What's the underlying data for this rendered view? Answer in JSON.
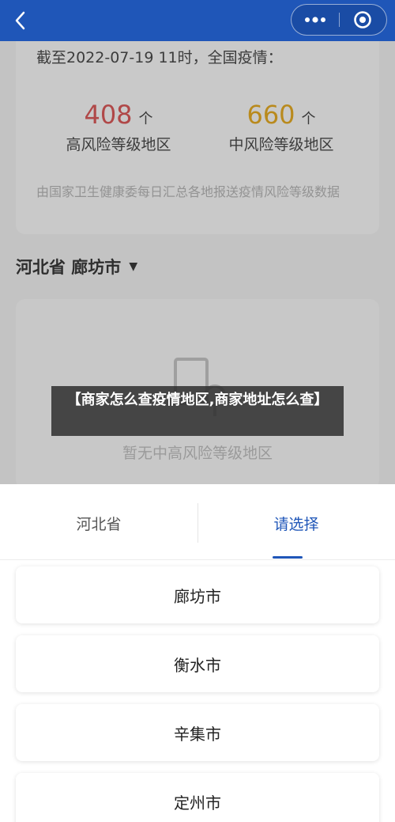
{
  "header": {
    "back_icon": "chevron-left-icon",
    "more_icon": "more-dots-icon",
    "close_icon": "target-circle-icon"
  },
  "summary": {
    "as_of": "截至2022-07-19 11时，全国疫情：",
    "high_risk": {
      "count": "408",
      "unit": "个",
      "label": "高风险等级地区",
      "color": "#b04848"
    },
    "mid_risk": {
      "count": "660",
      "unit": "个",
      "label": "中风险等级地区",
      "color": "#b98a1d"
    },
    "note": "由国家卫生健康委每日汇总各地报送疫情风险等级数据"
  },
  "region": {
    "title": "河北省 廊坊市"
  },
  "empty_state": {
    "text": "暂无中高风险等级地区"
  },
  "banner": {
    "text": "【商家怎么查疫情地区,商家地址怎么查】"
  },
  "picker": {
    "tabs": [
      {
        "label": "河北省"
      },
      {
        "label": "请选择"
      }
    ],
    "accent": "#1f56b8",
    "cities": [
      "廊坊市",
      "衡水市",
      "辛集市",
      "定州市"
    ]
  }
}
